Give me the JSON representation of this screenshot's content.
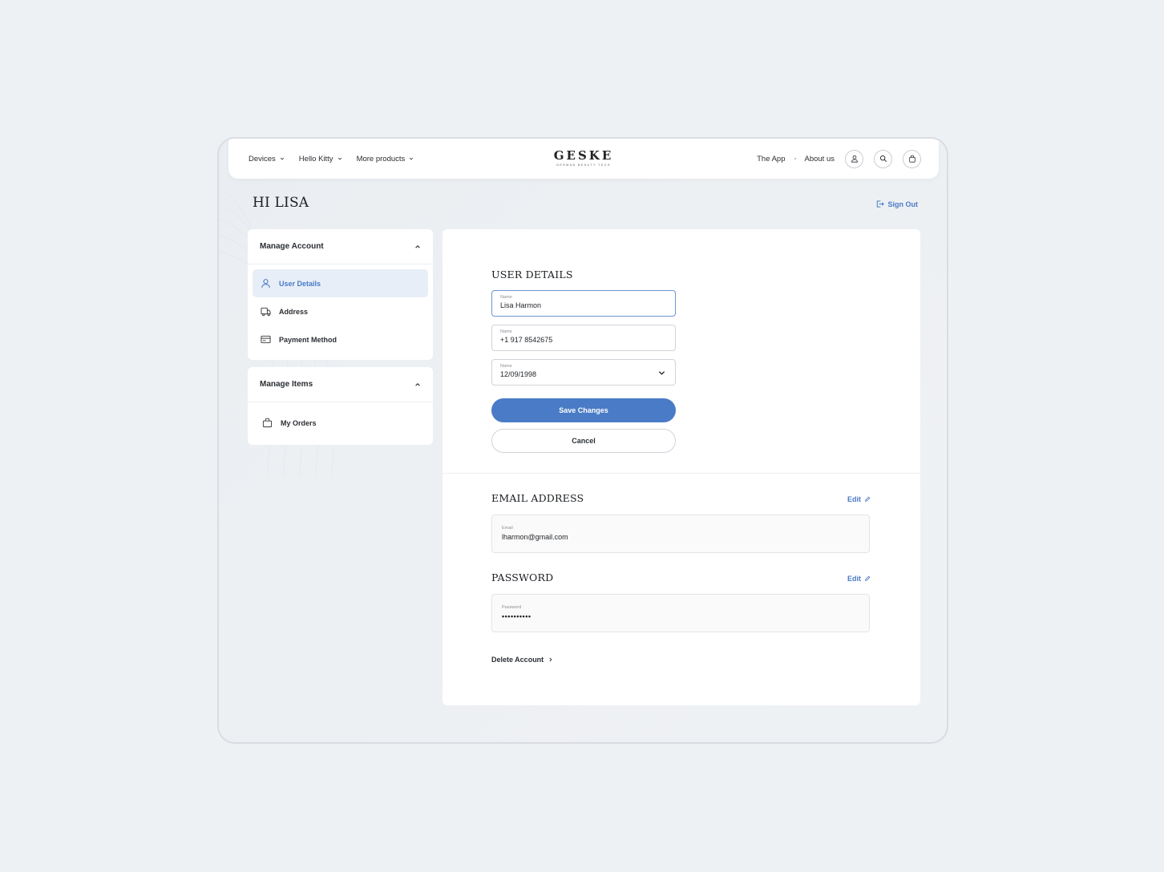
{
  "nav": {
    "left_items": [
      "Devices",
      "Hello Kitty",
      "More products"
    ],
    "logo": "GESKE",
    "logo_tagline": "GERMAN BEAUTY TECH",
    "right_links": [
      "The App",
      "About us"
    ],
    "icons": [
      "user-icon",
      "search-icon",
      "bag-icon"
    ]
  },
  "greeting": "HI LISA",
  "sign_out": "Sign Out",
  "sidebar": {
    "account": {
      "title": "Manage Account",
      "items": [
        {
          "label": "User Details",
          "icon": "user-icon",
          "active": true
        },
        {
          "label": "Address",
          "icon": "truck-icon",
          "active": false
        },
        {
          "label": "Payment Method",
          "icon": "card-icon",
          "active": false
        }
      ]
    },
    "items_group": {
      "title": "Manage Items",
      "items": [
        {
          "label": "My Orders",
          "icon": "bag-icon",
          "active": false
        }
      ]
    }
  },
  "user_details": {
    "title": "USER DETAILS",
    "fields": [
      {
        "label": "Name",
        "value": "Lisa Harmon"
      },
      {
        "label": "Name",
        "value": "+1 917 8542675"
      },
      {
        "label": "Name",
        "value": "12/09/1998"
      }
    ],
    "save_label": "Save Changes",
    "cancel_label": "Cancel"
  },
  "email": {
    "title": "EMAIL ADDRESS",
    "edit_label": "Edit",
    "field_label": "Email",
    "value": "lharmon@gmail.com"
  },
  "password": {
    "title": "PASSWORD",
    "edit_label": "Edit",
    "field_label": "Password",
    "value": "••••••••••"
  },
  "delete_label": "Delete Account",
  "colors": {
    "accent": "#4a7bc6",
    "background": "#eef1f4"
  }
}
